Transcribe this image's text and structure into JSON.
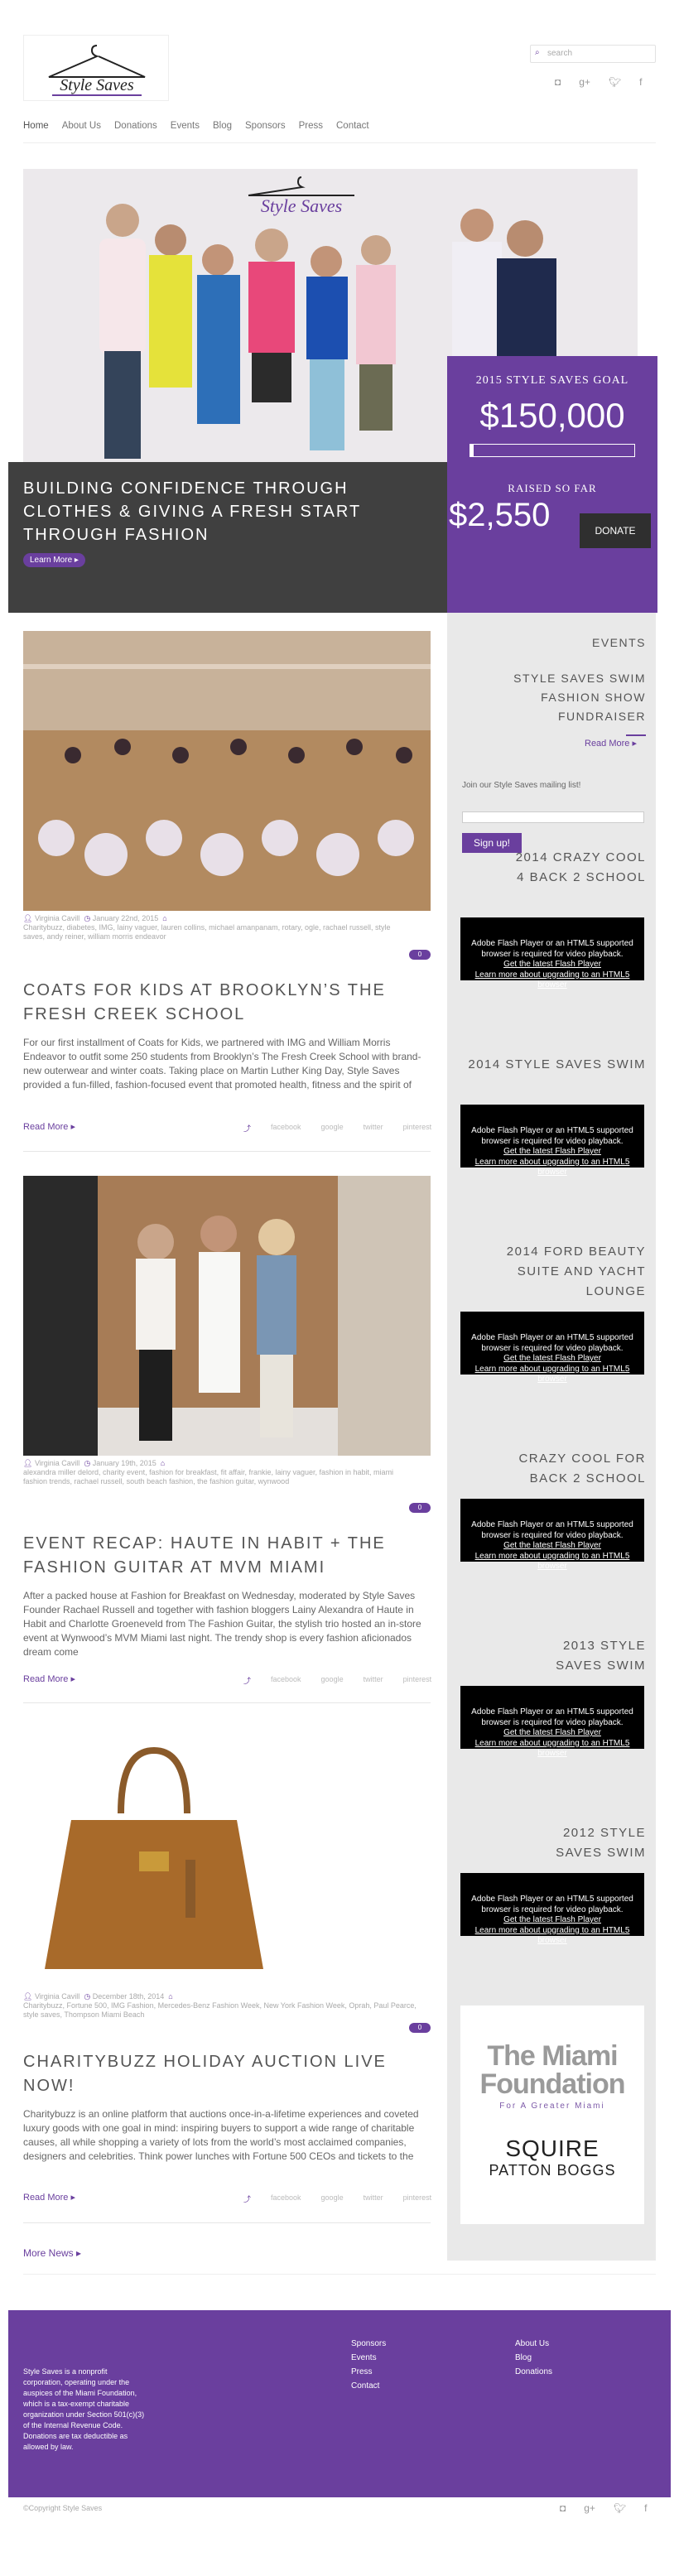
{
  "header": {
    "logo_text": "Style Saves",
    "search_placeholder": "search"
  },
  "nav": [
    "Home",
    "About Us",
    "Donations",
    "Events",
    "Blog",
    "Sponsors",
    "Press",
    "Contact"
  ],
  "hero": {
    "logo_text": "Style Saves",
    "banner_title": "Building confidence through clothes & giving a fresh start through fashion",
    "learn_more": "Learn More ▸"
  },
  "goal": {
    "label": "2015 Style Saves Goal",
    "amount": "$150,000",
    "progress": 0.02,
    "raised_label": "Raised so far",
    "raised": "$2,550",
    "donate": "Donate"
  },
  "posts": [
    {
      "meta_author": "Virginia Cavill",
      "meta_date": "January 22nd, 2015",
      "meta_tags": "Charitybuzz, diabetes, IMG, lainy vaguer, lauren collins, michael amanpanam, rotary, ogle, rachael russell, style saves, andy reiner, william morris endeavor",
      "comments": "0",
      "title": "Coats for Kids at Brooklyn’s The Fresh Creek School",
      "excerpt": "For our first installment of Coats for Kids, we partnered with IMG and William Morris Endeavor to outfit some 250 students from Brooklyn’s The Fresh Creek School with brand-new outerwear and winter coats. Taking place on Martin Luther King Day, Style Saves provided a fun-filled, fashion-focused event that promoted health, fitness and the spirit of",
      "read_more": "Read More ▸"
    },
    {
      "meta_author": "Virginia Cavill",
      "meta_date": "January 19th, 2015",
      "meta_tags": "alexandra miller delord, charity event, fashion for breakfast, fit affair, frankie, lainy vaguer, fashion in habit, miami fashion trends, rachael russell, south beach fashion, the fashion guitar, wynwood",
      "comments": "0",
      "title": "Event Recap: Haute in Habit + The Fashion Guitar at MVM Miami",
      "excerpt": "After a packed house at Fashion for Breakfast on Wednesday, moderated by Style Saves Founder Rachael Russell and together with fashion bloggers Lainy Alexandra of Haute in Habit and Charlotte Groeneveld from The Fashion Guitar, the stylish trio hosted an in-store event at Wynwood’s MVM Miami last night. The trendy shop is every fashion aficionados dream come",
      "read_more": "Read More ▸"
    },
    {
      "meta_author": "Virginia Cavill",
      "meta_date": "December 18th, 2014",
      "meta_tags": "Charitybuzz, Fortune 500, IMG Fashion, Mercedes-Benz Fashion Week, New York Fashion Week, Oprah, Paul Pearce, style saves, Thompson Miami Beach",
      "comments": "0",
      "title": "CharityBuzz Holiday Auction Live Now!",
      "excerpt": "Charitybuzz is an online platform that auctions once-in-a-lifetime experiences and coveted luxury goods with one goal in mind: inspiring buyers to support a wide range of charitable causes, all while shopping a variety of lots from the world’s most acclaimed companies, designers and celebrities. Think power lunches with Fortune 500 CEOs and tickets to the",
      "read_more": "Read More ▸"
    }
  ],
  "share": [
    "facebook",
    "google",
    "twitter",
    "pinterest"
  ],
  "more_news": "More News ▸",
  "sidebar": {
    "events_title": "Events",
    "event_name": "Style Saves Swim Fashion Show Fundraiser",
    "read_more": "Read More ▸",
    "mailing_text": "Join our Style Saves mailing list!",
    "signup": "Sign up!",
    "videos": [
      {
        "title": "2014 Crazy Cool 4 Back 2 School"
      },
      {
        "title": "2014 Style Saves Swim"
      },
      {
        "title": "2014 Ford Beauty Suite and Yacht Lounge"
      },
      {
        "title": "Crazy Cool for Back 2 School"
      },
      {
        "title": "2013 Style Saves Swim"
      },
      {
        "title": "2012 Style Saves Swim"
      }
    ],
    "flash": {
      "line1": "Adobe Flash Player or an HTML5 supported browser is required for video playback.",
      "line2": "Get the latest Flash Player",
      "line3": "Learn more about upgrading to an HTML5 browser"
    },
    "sponsor1_title": "The Miami Foundation",
    "sponsor1_sub": "For A Greater Miami",
    "sponsor2_line1": "SQUIRE",
    "sponsor2_line2": "PATTON BOGGS"
  },
  "footer": {
    "about": "Style Saves is a nonprofit corporation, operating under the auspices of the Miami Foundation, which is a tax-exempt charitable organization under Section 501(c)(3) of the Internal Revenue Code. Donations are tax deductible as allowed by law.",
    "col1": [
      "Sponsors",
      "Events",
      "Press",
      "Contact"
    ],
    "col2": [
      "About Us",
      "Blog",
      "Donations"
    ],
    "copyright": "©Copyright Style Saves"
  },
  "colors": {
    "purple": "#6a3f9e",
    "dark": "#404040",
    "sidebar": "#e9e9e9"
  }
}
